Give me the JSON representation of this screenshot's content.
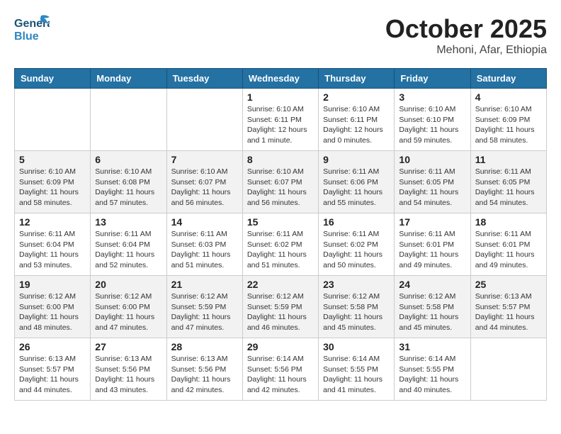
{
  "header": {
    "logo": {
      "line1": "General",
      "line2": "Blue"
    },
    "title": "October 2025",
    "subtitle": "Mehoni, Afar, Ethiopia"
  },
  "weekdays": [
    "Sunday",
    "Monday",
    "Tuesday",
    "Wednesday",
    "Thursday",
    "Friday",
    "Saturday"
  ],
  "weeks": [
    [
      {
        "day": "",
        "info": ""
      },
      {
        "day": "",
        "info": ""
      },
      {
        "day": "",
        "info": ""
      },
      {
        "day": "1",
        "info": "Sunrise: 6:10 AM\nSunset: 6:11 PM\nDaylight: 12 hours\nand 1 minute."
      },
      {
        "day": "2",
        "info": "Sunrise: 6:10 AM\nSunset: 6:11 PM\nDaylight: 12 hours\nand 0 minutes."
      },
      {
        "day": "3",
        "info": "Sunrise: 6:10 AM\nSunset: 6:10 PM\nDaylight: 11 hours\nand 59 minutes."
      },
      {
        "day": "4",
        "info": "Sunrise: 6:10 AM\nSunset: 6:09 PM\nDaylight: 11 hours\nand 58 minutes."
      }
    ],
    [
      {
        "day": "5",
        "info": "Sunrise: 6:10 AM\nSunset: 6:09 PM\nDaylight: 11 hours\nand 58 minutes."
      },
      {
        "day": "6",
        "info": "Sunrise: 6:10 AM\nSunset: 6:08 PM\nDaylight: 11 hours\nand 57 minutes."
      },
      {
        "day": "7",
        "info": "Sunrise: 6:10 AM\nSunset: 6:07 PM\nDaylight: 11 hours\nand 56 minutes."
      },
      {
        "day": "8",
        "info": "Sunrise: 6:10 AM\nSunset: 6:07 PM\nDaylight: 11 hours\nand 56 minutes."
      },
      {
        "day": "9",
        "info": "Sunrise: 6:11 AM\nSunset: 6:06 PM\nDaylight: 11 hours\nand 55 minutes."
      },
      {
        "day": "10",
        "info": "Sunrise: 6:11 AM\nSunset: 6:05 PM\nDaylight: 11 hours\nand 54 minutes."
      },
      {
        "day": "11",
        "info": "Sunrise: 6:11 AM\nSunset: 6:05 PM\nDaylight: 11 hours\nand 54 minutes."
      }
    ],
    [
      {
        "day": "12",
        "info": "Sunrise: 6:11 AM\nSunset: 6:04 PM\nDaylight: 11 hours\nand 53 minutes."
      },
      {
        "day": "13",
        "info": "Sunrise: 6:11 AM\nSunset: 6:04 PM\nDaylight: 11 hours\nand 52 minutes."
      },
      {
        "day": "14",
        "info": "Sunrise: 6:11 AM\nSunset: 6:03 PM\nDaylight: 11 hours\nand 51 minutes."
      },
      {
        "day": "15",
        "info": "Sunrise: 6:11 AM\nSunset: 6:02 PM\nDaylight: 11 hours\nand 51 minutes."
      },
      {
        "day": "16",
        "info": "Sunrise: 6:11 AM\nSunset: 6:02 PM\nDaylight: 11 hours\nand 50 minutes."
      },
      {
        "day": "17",
        "info": "Sunrise: 6:11 AM\nSunset: 6:01 PM\nDaylight: 11 hours\nand 49 minutes."
      },
      {
        "day": "18",
        "info": "Sunrise: 6:11 AM\nSunset: 6:01 PM\nDaylight: 11 hours\nand 49 minutes."
      }
    ],
    [
      {
        "day": "19",
        "info": "Sunrise: 6:12 AM\nSunset: 6:00 PM\nDaylight: 11 hours\nand 48 minutes."
      },
      {
        "day": "20",
        "info": "Sunrise: 6:12 AM\nSunset: 6:00 PM\nDaylight: 11 hours\nand 47 minutes."
      },
      {
        "day": "21",
        "info": "Sunrise: 6:12 AM\nSunset: 5:59 PM\nDaylight: 11 hours\nand 47 minutes."
      },
      {
        "day": "22",
        "info": "Sunrise: 6:12 AM\nSunset: 5:59 PM\nDaylight: 11 hours\nand 46 minutes."
      },
      {
        "day": "23",
        "info": "Sunrise: 6:12 AM\nSunset: 5:58 PM\nDaylight: 11 hours\nand 45 minutes."
      },
      {
        "day": "24",
        "info": "Sunrise: 6:12 AM\nSunset: 5:58 PM\nDaylight: 11 hours\nand 45 minutes."
      },
      {
        "day": "25",
        "info": "Sunrise: 6:13 AM\nSunset: 5:57 PM\nDaylight: 11 hours\nand 44 minutes."
      }
    ],
    [
      {
        "day": "26",
        "info": "Sunrise: 6:13 AM\nSunset: 5:57 PM\nDaylight: 11 hours\nand 44 minutes."
      },
      {
        "day": "27",
        "info": "Sunrise: 6:13 AM\nSunset: 5:56 PM\nDaylight: 11 hours\nand 43 minutes."
      },
      {
        "day": "28",
        "info": "Sunrise: 6:13 AM\nSunset: 5:56 PM\nDaylight: 11 hours\nand 42 minutes."
      },
      {
        "day": "29",
        "info": "Sunrise: 6:14 AM\nSunset: 5:56 PM\nDaylight: 11 hours\nand 42 minutes."
      },
      {
        "day": "30",
        "info": "Sunrise: 6:14 AM\nSunset: 5:55 PM\nDaylight: 11 hours\nand 41 minutes."
      },
      {
        "day": "31",
        "info": "Sunrise: 6:14 AM\nSunset: 5:55 PM\nDaylight: 11 hours\nand 40 minutes."
      },
      {
        "day": "",
        "info": ""
      }
    ]
  ]
}
